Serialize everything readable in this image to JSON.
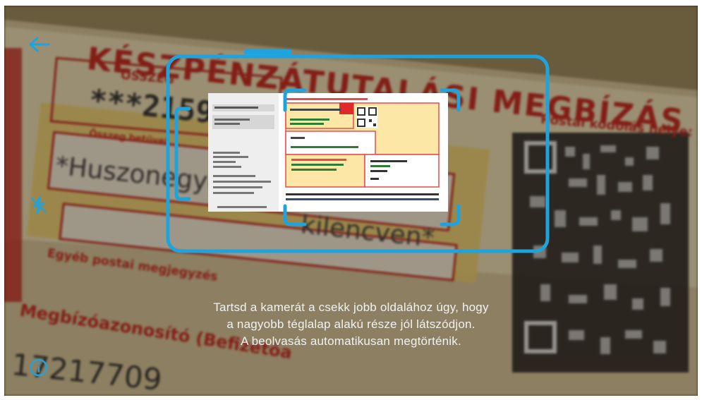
{
  "instruction": {
    "line1": "Tartsd a kamerát a csekk jobb oldalához úgy, hogy",
    "line2": "a nagyobb téglalap alakú része jól látszódjon.",
    "line3": "A beolvasás automatikusan megtörténik."
  },
  "background_slip": {
    "title": "KÉSZPÉNZÁTUTALÁSI MEGBÍZÁS",
    "amount_label": "ÖSSZEG",
    "amount_value": "***2159",
    "amount_words_label": "Összeg betűvel",
    "amount_words": "*Huszonegyezer",
    "amount_words_end": "kilencven*",
    "postal_label": "Postai kódolás helye:",
    "other_label": "Egyéb postai megjegyzés",
    "id_label": "Megbízóazonosító (Befizetőa",
    "id_value": "17217709"
  },
  "icons": {
    "back": "back-arrow-icon",
    "flash": "flash-off-icon",
    "info": "info-icon"
  },
  "colors": {
    "accent": "#1fa3dc",
    "slip_red": "#c8201a",
    "slip_yellow": "#f4d867"
  }
}
